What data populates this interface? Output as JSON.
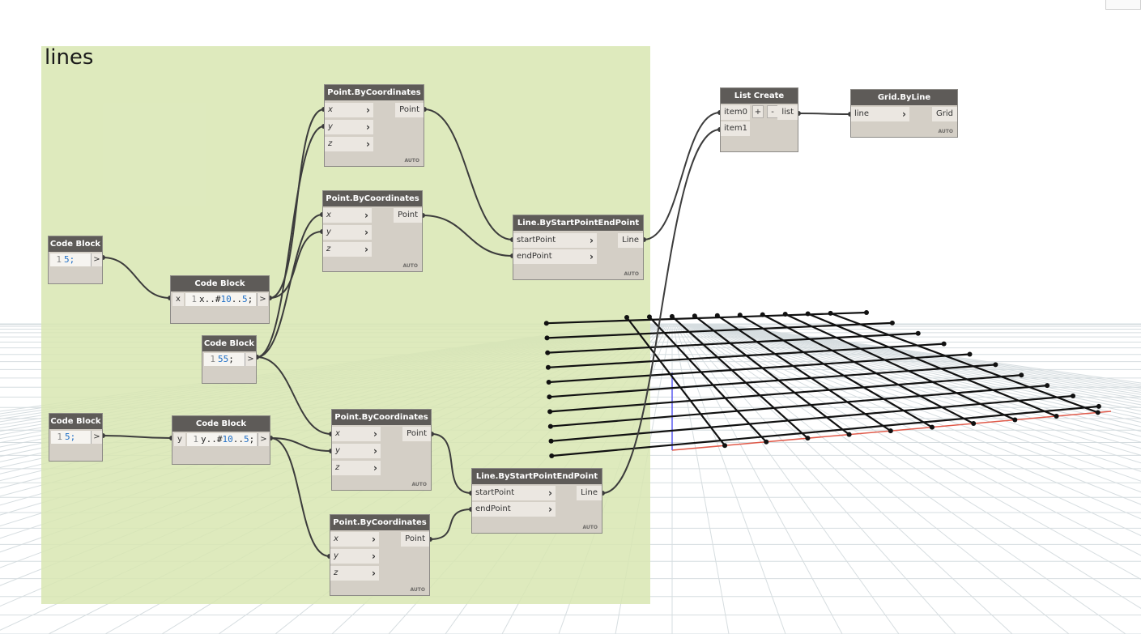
{
  "group": {
    "title": "lines",
    "color": "#d8e6b2"
  },
  "nodes": {
    "code_block_a": {
      "title": "Code Block",
      "line": "1",
      "code": "5;",
      "out": ">"
    },
    "code_block_b": {
      "title": "Code Block",
      "in": "x",
      "line": "1",
      "code_prefix": "x..#",
      "code_num1": "10",
      "code_mid": "..",
      "code_num2": "5",
      "code_suffix": ";",
      "out": ">"
    },
    "code_block_c": {
      "title": "Code Block",
      "line": "1",
      "code_num": "55",
      "code_suffix": ";",
      "out": ">"
    },
    "code_block_d": {
      "title": "Code Block",
      "line": "1",
      "code": "5;",
      "out": ">"
    },
    "code_block_e": {
      "title": "Code Block",
      "in": "y",
      "line": "1",
      "code_prefix": "y..#",
      "code_num1": "10",
      "code_mid": "..",
      "code_num2": "5",
      "code_suffix": ";",
      "out": ">"
    },
    "point_1": {
      "title": "Point.ByCoordinates",
      "inputs": [
        "x",
        "y",
        "z"
      ],
      "output": "Point",
      "lacing": "AUTO"
    },
    "point_2": {
      "title": "Point.ByCoordinates",
      "inputs": [
        "x",
        "y",
        "z"
      ],
      "output": "Point",
      "lacing": "AUTO"
    },
    "point_3": {
      "title": "Point.ByCoordinates",
      "inputs": [
        "x",
        "y",
        "z"
      ],
      "output": "Point",
      "lacing": "AUTO"
    },
    "point_4": {
      "title": "Point.ByCoordinates",
      "inputs": [
        "x",
        "y",
        "z"
      ],
      "output": "Point",
      "lacing": "AUTO"
    },
    "line_1": {
      "title": "Line.ByStartPointEndPoint",
      "inputs": [
        "startPoint",
        "endPoint"
      ],
      "output": "Line",
      "lacing": "AUTO"
    },
    "line_2": {
      "title": "Line.ByStartPointEndPoint",
      "inputs": [
        "startPoint",
        "endPoint"
      ],
      "output": "Line",
      "lacing": "AUTO"
    },
    "list_create": {
      "title": "List Create",
      "inputs": [
        "item0",
        "item1"
      ],
      "add": "+",
      "remove": "-",
      "output": "list"
    },
    "grid_by_line": {
      "title": "Grid.ByLine",
      "inputs": [
        "line"
      ],
      "output": "Grid",
      "lacing": "AUTO"
    }
  },
  "colors": {
    "node_header": "#5e5b58",
    "node_body": "#d4cfc6",
    "wire": "#3c3c3c",
    "number": "#1f6fc6",
    "x_axis": "#e05a4a",
    "y_axis": "#5a5af0"
  }
}
